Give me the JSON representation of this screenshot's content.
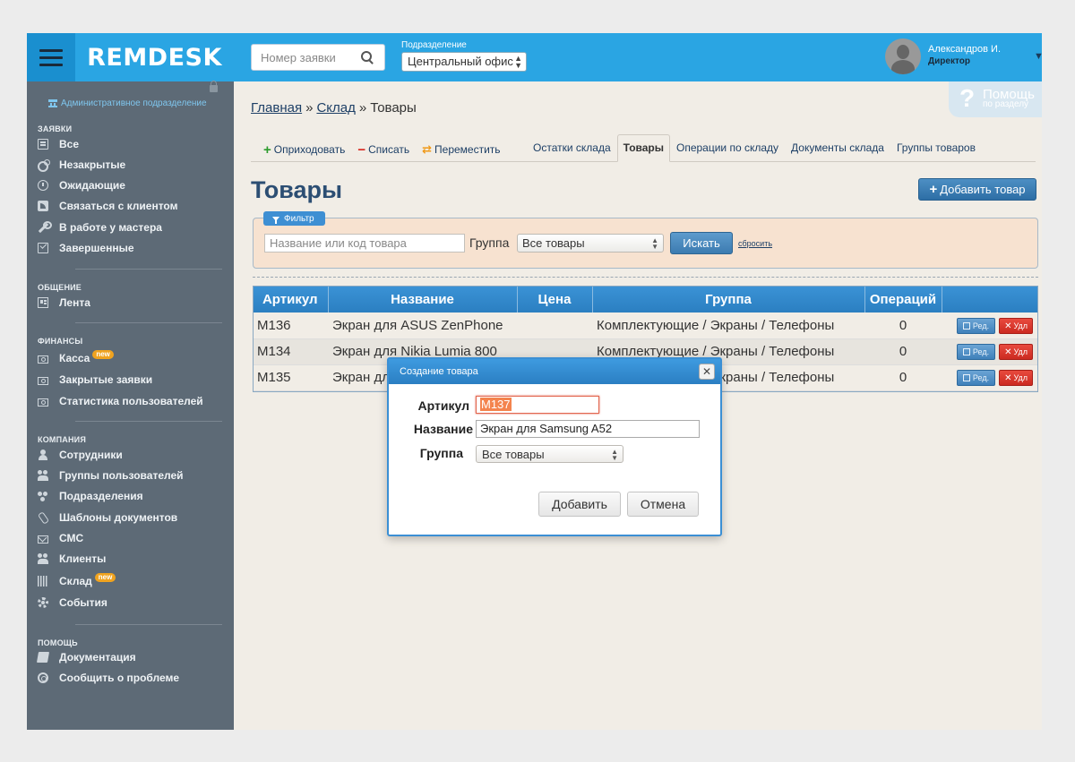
{
  "header": {
    "logo": "REMDESK",
    "search_placeholder": "Номер заявки",
    "department_label": "Подразделение",
    "department_value": "Центральный офис",
    "user_name": "Александров И.",
    "user_role": "Директор"
  },
  "sidebar": {
    "admin_link": "Административное подразделение",
    "sections": {
      "requests": "ЗАЯВКИ",
      "communication": "ОБЩЕНИЕ",
      "finance": "ФИНАНСЫ",
      "company": "КОМПАНИЯ",
      "help": "ПОМОЩЬ"
    },
    "items": {
      "all": "Все",
      "unclosed": "Незакрытые",
      "waiting": "Ожидающие",
      "contact_client": "Связаться с клиентом",
      "in_work": "В работе у мастера",
      "completed": "Завершенные",
      "feed": "Лента",
      "cashbox": "Касса",
      "closed_requests": "Закрытые заявки",
      "user_stats": "Статистика пользователей",
      "employees": "Сотрудники",
      "user_groups": "Группы пользователей",
      "divisions": "Подразделения",
      "doc_templates": "Шаблоны документов",
      "sms": "СМС",
      "clients": "Клиенты",
      "warehouse": "Склад",
      "events": "События",
      "documentation": "Документация",
      "report_problem": "Сообщить о проблеме"
    },
    "badge_new": "new"
  },
  "help": {
    "title": "Помощь",
    "subtitle": "по разделу"
  },
  "breadcrumb": {
    "home": "Главная",
    "warehouse": "Склад",
    "current": "Товары",
    "separator": "»"
  },
  "actions": {
    "receive": "Оприходовать",
    "write_off": "Списать",
    "move": "Переместить"
  },
  "tabs": {
    "stock": "Остатки склада",
    "goods": "Товары",
    "operations": "Операции по складу",
    "documents": "Документы склада",
    "groups": "Группы товаров"
  },
  "page": {
    "title": "Товары",
    "add_button": "Добавить товар"
  },
  "filter": {
    "tag": "Фильтр",
    "name_placeholder": "Название или код товара",
    "group_label": "Группа",
    "group_value": "Все товары",
    "search_button": "Искать",
    "reset_link": "сбросить"
  },
  "table": {
    "headers": [
      "Артикул",
      "Название",
      "Цена",
      "Группа",
      "Операций"
    ],
    "edit_label": "Ред.",
    "delete_label": "Удл",
    "rows": [
      {
        "sku": "M136",
        "name": "Экран для ASUS ZenPhone",
        "price": "",
        "group": "Комплектующие / Экраны / Телефоны",
        "ops": "0"
      },
      {
        "sku": "M134",
        "name": "Экран для Nikia Lumia 800",
        "price": "",
        "group": "Комплектующие / Экраны / Телефоны",
        "ops": "0"
      },
      {
        "sku": "M135",
        "name": "Экран для ASUS ZenPhone",
        "price": "",
        "group": "Комплектующие / Экраны / Телефоны",
        "ops": "0"
      }
    ]
  },
  "modal": {
    "title": "Создание товара",
    "sku_label": "Артикул",
    "sku_value": "M137",
    "name_label": "Название",
    "name_value": "Экран для Samsung A52",
    "group_label": "Группа",
    "group_value": "Все товары",
    "add_button": "Добавить",
    "cancel_button": "Отмена"
  }
}
